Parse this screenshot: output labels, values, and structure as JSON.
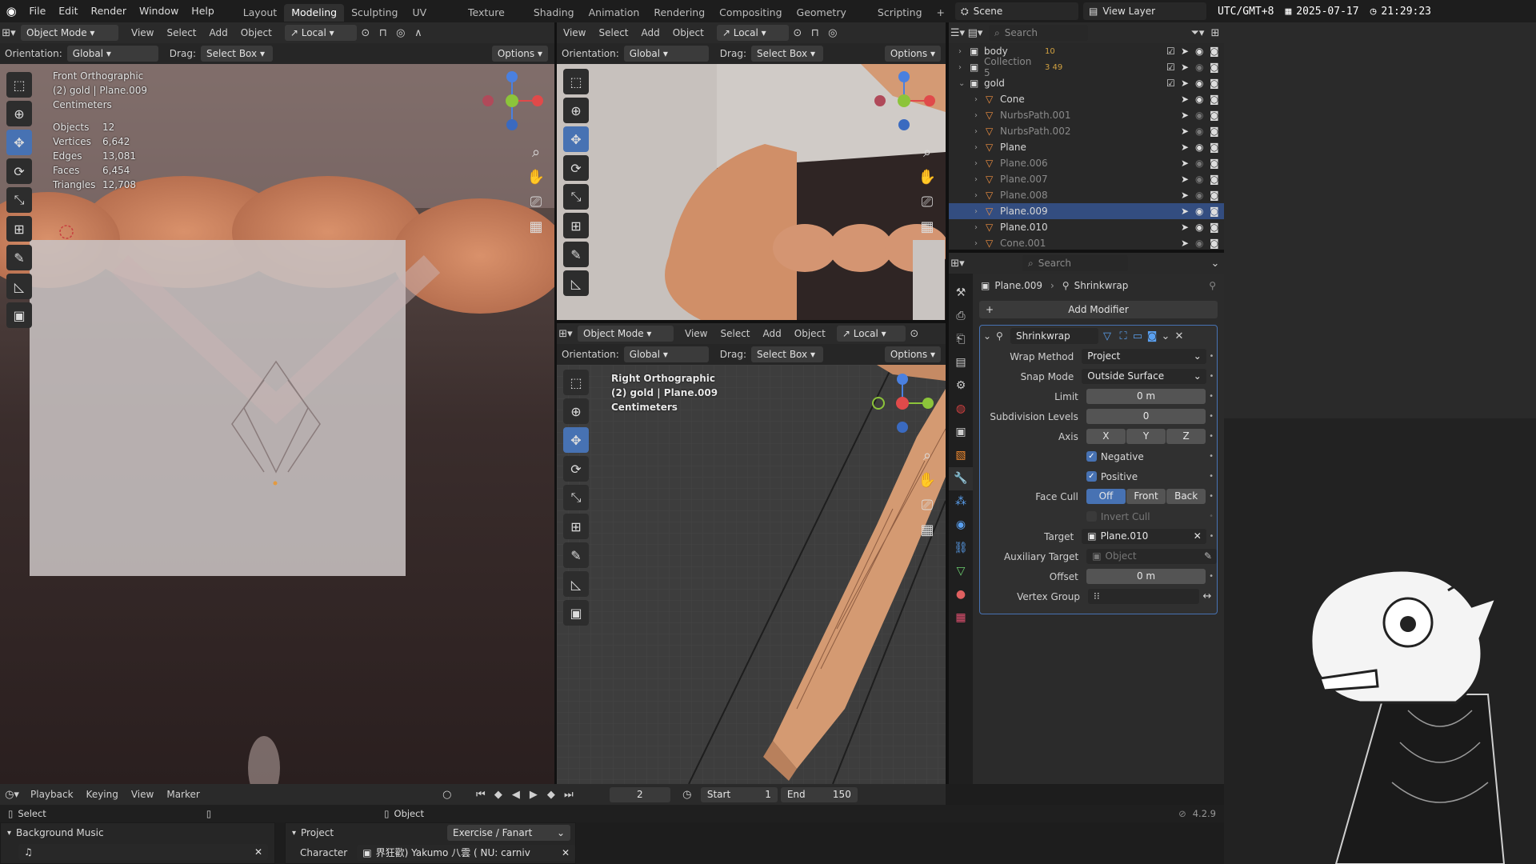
{
  "menubar": {
    "items": [
      "File",
      "Edit",
      "Render",
      "Window",
      "Help"
    ],
    "workspaces": [
      "Layout",
      "Modeling",
      "Sculpting",
      "UV Editing",
      "Texture Paint",
      "Shading",
      "Animation",
      "Rendering",
      "Compositing",
      "Geometry Nodes",
      "Scripting"
    ],
    "active_workspace": "Modeling",
    "add_tab": "+"
  },
  "topright": {
    "scene_label": "Scene",
    "view_layer_label": "View Layer"
  },
  "clock": {
    "timezone": "UTC/GMT+8",
    "date": "2025-07-17",
    "time": "21:29:23"
  },
  "viewport_main": {
    "mode": "Object Mode",
    "menus": [
      "View",
      "Select",
      "Add",
      "Object"
    ],
    "transform_space": "Local",
    "orientation_label": "Orientation:",
    "orientation_value": "Global",
    "drag_label": "Drag:",
    "drag_value": "Select Box",
    "options": "Options",
    "view_name": "Front Orthographic",
    "collection_info": "(2) gold | Plane.009",
    "units": "Centimeters",
    "stats": [
      {
        "label": "Objects",
        "value": "12"
      },
      {
        "label": "Vertices",
        "value": "6,642"
      },
      {
        "label": "Edges",
        "value": "13,081"
      },
      {
        "label": "Faces",
        "value": "6,454"
      },
      {
        "label": "Triangles",
        "value": "12,708"
      }
    ]
  },
  "viewport_top_right": {
    "menus": [
      "View",
      "Select",
      "Add",
      "Object"
    ],
    "transform_space": "Local",
    "orientation_label": "Orientation:",
    "orientation_value": "Global",
    "drag_label": "Drag:",
    "drag_value": "Select Box",
    "options": "Options"
  },
  "viewport_bottom_right": {
    "mode": "Object Mode",
    "menus": [
      "View",
      "Select",
      "Add",
      "Object"
    ],
    "transform_space": "Local",
    "orientation_label": "Orientation:",
    "orientation_value": "Global",
    "drag_label": "Drag:",
    "drag_value": "Select Box",
    "options": "Options",
    "view_name": "Right Orthographic",
    "collection_info": "(2) gold | Plane.009",
    "units": "Centimeters"
  },
  "outliner": {
    "search_placeholder": "Search",
    "rows": [
      {
        "name": "body",
        "badge": "10",
        "indent": 0
      },
      {
        "name": "Collection 5",
        "badge": "3  49",
        "indent": 0,
        "dim": true
      },
      {
        "name": "gold",
        "indent": 0,
        "expanded": true
      },
      {
        "name": "Cone",
        "indent": 1
      },
      {
        "name": "NurbsPath.001",
        "indent": 1,
        "dim": true
      },
      {
        "name": "NurbsPath.002",
        "indent": 1,
        "dim": true
      },
      {
        "name": "Plane",
        "indent": 1
      },
      {
        "name": "Plane.006",
        "indent": 1,
        "dim": true
      },
      {
        "name": "Plane.007",
        "indent": 1,
        "dim": true
      },
      {
        "name": "Plane.008",
        "indent": 1,
        "dim": true
      },
      {
        "name": "Plane.009",
        "indent": 1,
        "selected": true
      },
      {
        "name": "Plane.010",
        "indent": 1
      },
      {
        "name": "Cone.001",
        "indent": 1,
        "dim": true
      }
    ]
  },
  "properties": {
    "search_placeholder": "Search",
    "breadcrumb_object": "Plane.009",
    "breadcrumb_modifier": "Shrinkwrap",
    "add_modifier": "Add Modifier",
    "modifier_name": "Shrinkwrap",
    "wrap_method_label": "Wrap Method",
    "wrap_method": "Project",
    "snap_mode_label": "Snap Mode",
    "snap_mode": "Outside Surface",
    "limit_label": "Limit",
    "limit": "0 m",
    "subdiv_label": "Subdivision Levels",
    "subdiv": "0",
    "axis_label": "Axis",
    "axis": [
      "X",
      "Y",
      "Z"
    ],
    "negative": "Negative",
    "positive": "Positive",
    "face_cull_label": "Face Cull",
    "face_cull": [
      "Off",
      "Front",
      "Back"
    ],
    "invert_cull": "Invert Cull",
    "target_label": "Target",
    "target": "Plane.010",
    "aux_target_label": "Auxiliary Target",
    "aux_target_placeholder": "Object",
    "offset_label": "Offset",
    "offset": "0 m",
    "vertex_group_label": "Vertex Group"
  },
  "timeline": {
    "menus": [
      "Playback",
      "Keying",
      "View",
      "Marker"
    ],
    "current_frame": "2",
    "start_label": "Start",
    "start": "1",
    "end_label": "End",
    "end": "150"
  },
  "statusbar": {
    "select": "Select",
    "object": "Object",
    "version": "4.2.9"
  },
  "bottom_panels": {
    "music_title": "Background Music",
    "project_title": "Project",
    "project_value": "Exercise / Fanart",
    "character_label": "Character",
    "character_value": "界狂歡) Yakumo 八雲 ( NU: carniv"
  }
}
